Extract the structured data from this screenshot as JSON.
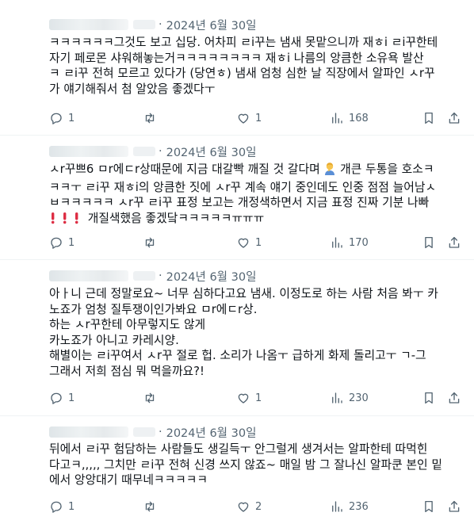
{
  "tweets": [
    {
      "time": "2024년 6월 30일",
      "lines": [
        "ㅋㅋㅋㅋㅋㅋ그것도 보고 십당. 어차피 ㄹi꾸는 냄새 못맡으니까 재ㅎi ㄹi꾸한테",
        "자기 페로몬 샤워해놓는거ㅋㅋㅋㅋㅋㅋㅋㅋ 재ㅎi 나름의 앙큼한 소유욕 발산",
        "ㅋ ㄹi꾸 전혀 모르고 있다가 (당연ㅎ) 냄새 엄청 심한 날 직장에서 알파인 ㅅr꾸",
        "가 얘기해줘서 첨 알았음 좋겠다ㅜ"
      ],
      "replies": "1",
      "retweets": "",
      "likes": "1",
      "views": "168"
    },
    {
      "time": "2024년 6월 30일",
      "lines": [
        "ㅅr꾸쁘6 ㅁr에ㄷr상때문에 지금 대갈빡 깨질 것 갈다며 ",
        "ㅋㅋㅜ ㄹi꾸 재ㅎi의 앙큼한 짓에 ㅅr꾸 계속 얘기 중인데도 인중 점점 늘어남ㅅ",
        "ㅂㅋㅋㅋㅋㅋ ㅅr꾸 ㄹi꾸 표정 보고는 개정색하면서 지금 표정 진짜 기분 나빠",
        " 개질색했음 좋겠닼ㅋㅋㅋㅋㅋㅠㅠㅠ"
      ],
      "line1_tail": " 개큰 두통을 호소ㅋ",
      "replies": "1",
      "retweets": "",
      "likes": "1",
      "views": "170"
    },
    {
      "time": "2024년 6월 30일",
      "lines": [
        "아ㅏ니 근데 정말로요~ 너무 심하다고요 냄새. 이정도로 하는 사람 처음 봐ㅜ 카",
        "노죠가 엄청 질투쟁이인가봐요 ㅁr에ㄷr상.",
        "하는 ㅅr꾸한테 아무렇지도 않게",
        "카노죠가 아니고 카레시양.",
        "해별이는 ㄹi꾸여서 ㅅr꾸 절로 헙. 소리가 나옴ㅜ 급하게 화제 돌리고ㅜ ㄱ-그",
        "그래서 저희 점심 뭐 먹을까요?!"
      ],
      "replies": "1",
      "retweets": "",
      "likes": "1",
      "views": "230"
    },
    {
      "time": "2024년 6월 30일",
      "lines": [
        "뒤에서 ㄹi꾸 험담하는 사람들도 생길득ㅜ 안그럴게 생겨서는 알파한테 따먹힌",
        "다고ㅋ,,,,, 그치만 ㄹi꾸 전혀 신경 쓰지 않죠~ 매일 밤 그 잘나신 알파쿤 본인 밑",
        "에서 앙앙대기 때무네ㅋㅋㅋㅋㅋ"
      ],
      "replies": "1",
      "retweets": "",
      "likes": "2",
      "views": "236"
    }
  ],
  "icons": {
    "reply": "reply-icon",
    "retweet": "retweet-icon",
    "like": "heart-icon",
    "views": "views-icon",
    "bookmark": "bookmark-icon",
    "share": "share-icon"
  },
  "separator": "·"
}
